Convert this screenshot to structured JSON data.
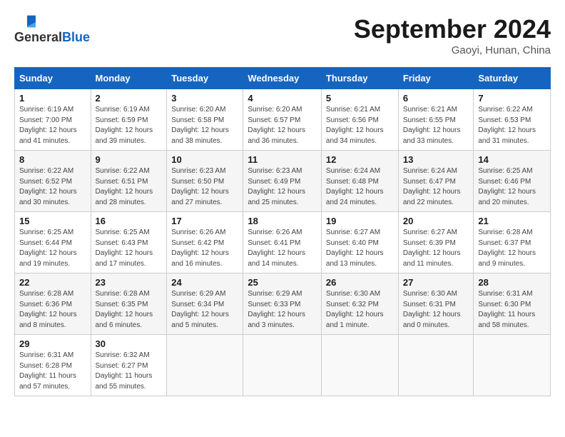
{
  "header": {
    "logo_general": "General",
    "logo_blue": "Blue",
    "month_title": "September 2024",
    "subtitle": "Gaoyi, Hunan, China"
  },
  "weekdays": [
    "Sunday",
    "Monday",
    "Tuesday",
    "Wednesday",
    "Thursday",
    "Friday",
    "Saturday"
  ],
  "weeks": [
    [
      {
        "day": "1",
        "sunrise": "6:19 AM",
        "sunset": "7:00 PM",
        "daylight": "12 hours and 41 minutes."
      },
      {
        "day": "2",
        "sunrise": "6:19 AM",
        "sunset": "6:59 PM",
        "daylight": "12 hours and 39 minutes."
      },
      {
        "day": "3",
        "sunrise": "6:20 AM",
        "sunset": "6:58 PM",
        "daylight": "12 hours and 38 minutes."
      },
      {
        "day": "4",
        "sunrise": "6:20 AM",
        "sunset": "6:57 PM",
        "daylight": "12 hours and 36 minutes."
      },
      {
        "day": "5",
        "sunrise": "6:21 AM",
        "sunset": "6:56 PM",
        "daylight": "12 hours and 34 minutes."
      },
      {
        "day": "6",
        "sunrise": "6:21 AM",
        "sunset": "6:55 PM",
        "daylight": "12 hours and 33 minutes."
      },
      {
        "day": "7",
        "sunrise": "6:22 AM",
        "sunset": "6:53 PM",
        "daylight": "12 hours and 31 minutes."
      }
    ],
    [
      {
        "day": "8",
        "sunrise": "6:22 AM",
        "sunset": "6:52 PM",
        "daylight": "12 hours and 30 minutes."
      },
      {
        "day": "9",
        "sunrise": "6:22 AM",
        "sunset": "6:51 PM",
        "daylight": "12 hours and 28 minutes."
      },
      {
        "day": "10",
        "sunrise": "6:23 AM",
        "sunset": "6:50 PM",
        "daylight": "12 hours and 27 minutes."
      },
      {
        "day": "11",
        "sunrise": "6:23 AM",
        "sunset": "6:49 PM",
        "daylight": "12 hours and 25 minutes."
      },
      {
        "day": "12",
        "sunrise": "6:24 AM",
        "sunset": "6:48 PM",
        "daylight": "12 hours and 24 minutes."
      },
      {
        "day": "13",
        "sunrise": "6:24 AM",
        "sunset": "6:47 PM",
        "daylight": "12 hours and 22 minutes."
      },
      {
        "day": "14",
        "sunrise": "6:25 AM",
        "sunset": "6:46 PM",
        "daylight": "12 hours and 20 minutes."
      }
    ],
    [
      {
        "day": "15",
        "sunrise": "6:25 AM",
        "sunset": "6:44 PM",
        "daylight": "12 hours and 19 minutes."
      },
      {
        "day": "16",
        "sunrise": "6:25 AM",
        "sunset": "6:43 PM",
        "daylight": "12 hours and 17 minutes."
      },
      {
        "day": "17",
        "sunrise": "6:26 AM",
        "sunset": "6:42 PM",
        "daylight": "12 hours and 16 minutes."
      },
      {
        "day": "18",
        "sunrise": "6:26 AM",
        "sunset": "6:41 PM",
        "daylight": "12 hours and 14 minutes."
      },
      {
        "day": "19",
        "sunrise": "6:27 AM",
        "sunset": "6:40 PM",
        "daylight": "12 hours and 13 minutes."
      },
      {
        "day": "20",
        "sunrise": "6:27 AM",
        "sunset": "6:39 PM",
        "daylight": "12 hours and 11 minutes."
      },
      {
        "day": "21",
        "sunrise": "6:28 AM",
        "sunset": "6:37 PM",
        "daylight": "12 hours and 9 minutes."
      }
    ],
    [
      {
        "day": "22",
        "sunrise": "6:28 AM",
        "sunset": "6:36 PM",
        "daylight": "12 hours and 8 minutes."
      },
      {
        "day": "23",
        "sunrise": "6:28 AM",
        "sunset": "6:35 PM",
        "daylight": "12 hours and 6 minutes."
      },
      {
        "day": "24",
        "sunrise": "6:29 AM",
        "sunset": "6:34 PM",
        "daylight": "12 hours and 5 minutes."
      },
      {
        "day": "25",
        "sunrise": "6:29 AM",
        "sunset": "6:33 PM",
        "daylight": "12 hours and 3 minutes."
      },
      {
        "day": "26",
        "sunrise": "6:30 AM",
        "sunset": "6:32 PM",
        "daylight": "12 hours and 1 minute."
      },
      {
        "day": "27",
        "sunrise": "6:30 AM",
        "sunset": "6:31 PM",
        "daylight": "12 hours and 0 minutes."
      },
      {
        "day": "28",
        "sunrise": "6:31 AM",
        "sunset": "6:30 PM",
        "daylight": "11 hours and 58 minutes."
      }
    ],
    [
      {
        "day": "29",
        "sunrise": "6:31 AM",
        "sunset": "6:28 PM",
        "daylight": "11 hours and 57 minutes."
      },
      {
        "day": "30",
        "sunrise": "6:32 AM",
        "sunset": "6:27 PM",
        "daylight": "11 hours and 55 minutes."
      },
      null,
      null,
      null,
      null,
      null
    ]
  ]
}
